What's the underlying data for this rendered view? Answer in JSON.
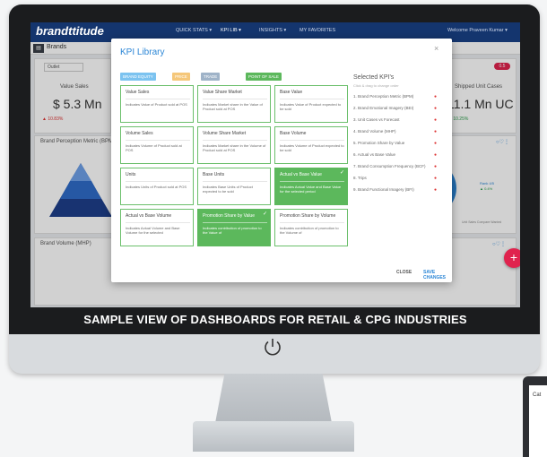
{
  "caption": "SAMPLE VIEW OF DASHBOARDS FOR RETAIL & CPG INDUSTRIES",
  "app": {
    "logo": "brandttitude",
    "nav": [
      "QUICK STATS ▾",
      "KPI LIB ▾",
      "INSIGHTS ▾",
      "MY FAVORITES"
    ],
    "welcome": "Welcome Praveen Kumar ▾",
    "section": "Brands",
    "filter": "Outlet",
    "value_sales": {
      "title": "Value Sales",
      "value": "$ 5.3 Mn",
      "delta": "▲ 10.83%"
    },
    "unit_cases": {
      "title": "Shipped Unit Cases",
      "value": "11.1 Mn UC",
      "delta": "▲ 10.25%"
    },
    "chart1_title": "Brand Perception Metric (BPM)",
    "chart2_title": "Brand Volume (MHP)",
    "badge": "0.5",
    "pie_label": "Rank 4/5",
    "pie_sub": "▲ 0.4%",
    "pie_caption": "Unit Sales Compare Wanted",
    "fab": "+",
    "side_header": "Cat"
  },
  "modal": {
    "title": "KPI Library",
    "close_icon": "×",
    "chips": [
      {
        "label": "BRAND EQUITY",
        "color": "#7cc3f0"
      },
      {
        "label": "PRICE",
        "color": "#f5c77a"
      },
      {
        "label": "TRADE",
        "color": "#9fb3c8"
      },
      {
        "label": "POINT OF SALE",
        "color": "#5cb85c"
      }
    ],
    "tiles": [
      {
        "title": "Value Sales",
        "desc": "Indicates Value of Product sold at POS",
        "selected": false
      },
      {
        "title": "Value Share Market",
        "desc": "Indicates Market share in the Value of Product sold at POS",
        "selected": false
      },
      {
        "title": "Base Value",
        "desc": "Indicates Value of Product expected to be sold",
        "selected": false
      },
      {
        "title": "Volume Sales",
        "desc": "Indicates Volume of Product sold at POS",
        "selected": false
      },
      {
        "title": "Volume Share Market",
        "desc": "Indicates Market share in the Volume of Product sold at POS",
        "selected": false
      },
      {
        "title": "Base Volume",
        "desc": "Indicates Volume of Product expected to be sold",
        "selected": false
      },
      {
        "title": "Units",
        "desc": "Indicates Units of Product sold at POS",
        "selected": false
      },
      {
        "title": "Base Units",
        "desc": "Indicates Base Units of Product expected to be sold",
        "selected": false
      },
      {
        "title": "Actual vs Base Value",
        "desc": "Indicates Actual Value and Base Value for the selected period",
        "selected": true
      },
      {
        "title": "Actual vs Base Volume",
        "desc": "Indicates Actual Volume and Base Volume for the selected",
        "selected": false
      },
      {
        "title": "Promotion Share by Value",
        "desc": "Indicates contribution of promotion to the Value of",
        "selected": true
      },
      {
        "title": "Promotion Share by Volume",
        "desc": "Indicates contribution of promotion to the Volume of",
        "selected": false
      }
    ],
    "selected_title": "Selected KPI's",
    "selected_sub": "Click & drag to change order",
    "selected": [
      "1. Brand Perception Metric (BPM)",
      "2. Brand Emotional Imagery (BEI)",
      "3. Unit Cases vs Forecast",
      "4. Brand Volume (MHP)",
      "5. Promotion Share by Value",
      "6. Actual vs Base Value",
      "7. Brand Consumption Frequency (BCF)",
      "8. Trips",
      "9. Brand Functional Imagery (BFI)"
    ],
    "close_btn": "CLOSE",
    "save_btn": "SAVE CHANGES"
  }
}
